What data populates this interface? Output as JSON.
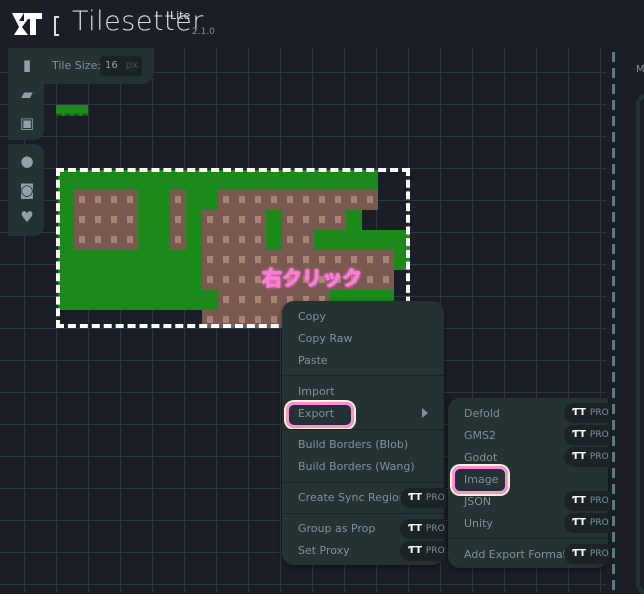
{
  "app": {
    "title": "Tilesetter",
    "edition": "Lite",
    "version": "2.1.0"
  },
  "toolbar": {
    "tile_size_label": "Tile Size:",
    "tile_size_value": "16",
    "tile_size_unit": "px"
  },
  "sidebar": {
    "top": [
      {
        "icon": "new-file-icon"
      },
      {
        "icon": "open-folder-icon"
      },
      {
        "icon": "save-icon"
      }
    ],
    "bottom": [
      {
        "icon": "help-icon"
      },
      {
        "icon": "discord-icon"
      },
      {
        "icon": "twitter-icon"
      }
    ]
  },
  "annotation": "右クリック",
  "right_panel": {
    "label": "M"
  },
  "context_menu": {
    "items": [
      "Copy",
      "Copy Raw",
      "Paste",
      "Import",
      "Export",
      "Build Borders (Blob)",
      "Build Borders (Wang)",
      "Create Sync Region",
      "Group as Prop",
      "Set Proxy"
    ],
    "highlighted": "Export"
  },
  "submenu": {
    "items": [
      "Defold",
      "GMS2",
      "Godot",
      "Image",
      "JSON",
      "Unity",
      "Add Export Format"
    ],
    "highlighted": "Image"
  },
  "pro_badge": {
    "logo": "ƬT",
    "label": "PRO"
  },
  "colors": {
    "highlight": "#ff8de0",
    "grass": "#1b8a1b",
    "dirt": "#7a5a50",
    "menu_bg": "#253234"
  }
}
